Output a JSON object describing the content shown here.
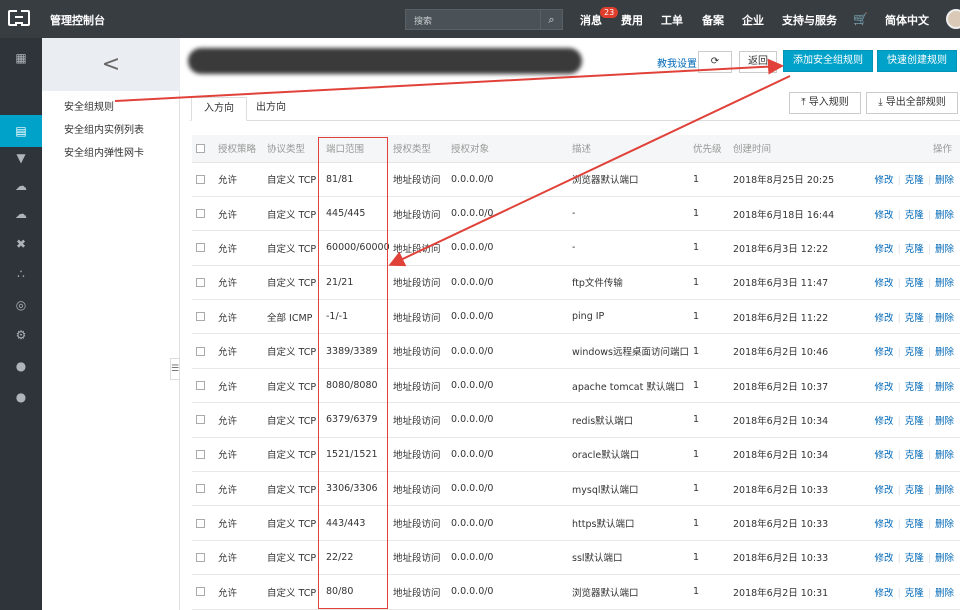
{
  "topbar": {
    "title": "管理控制台",
    "search_placeholder": "搜索",
    "nav": {
      "messages": "消息",
      "message_count": "23",
      "billing": "费用",
      "tickets": "工单",
      "icp": "备案",
      "enterprise": "企业",
      "support": "支持与服务",
      "language": "简体中文"
    }
  },
  "icons": [
    "grid-icon",
    "server-icon",
    "database-icon",
    "cloud-icon",
    "upload-cloud-icon",
    "network-icon",
    "nodes-icon",
    "globe-icon",
    "gear-icon",
    "dot-icon",
    "dot-icon"
  ],
  "subnav": {
    "back": "<",
    "items": [
      "安全组规则",
      "安全组内实例列表",
      "安全组内弹性网卡"
    ]
  },
  "header": {
    "help": "教我设置",
    "refresh": "⟳",
    "back": "返回",
    "add_rule": "添加安全组规则",
    "quick_create": "快速创建规则"
  },
  "tabs": {
    "inbound": "入方向",
    "outbound": "出方向"
  },
  "toolbar": {
    "import": "导入规则",
    "export": "导出全部规则"
  },
  "table": {
    "headers": [
      "授权策略",
      "协议类型",
      "端口范围",
      "授权类型",
      "授权对象",
      "描述",
      "优先级",
      "创建时间",
      "操作"
    ],
    "actions": {
      "edit": "修改",
      "clone": "克隆",
      "delete": "删除"
    },
    "rows": [
      {
        "policy": "允许",
        "protocol": "自定义 TCP",
        "port": "81/81",
        "auth_type": "地址段访问",
        "target": "0.0.0.0/0",
        "desc": "浏览器默认端口",
        "priority": "1",
        "created": "2018年8月25日 20:25"
      },
      {
        "policy": "允许",
        "protocol": "自定义 TCP",
        "port": "445/445",
        "auth_type": "地址段访问",
        "target": "0.0.0.0/0",
        "desc": "-",
        "priority": "1",
        "created": "2018年6月18日 16:44"
      },
      {
        "policy": "允许",
        "protocol": "自定义 TCP",
        "port": "60000/60000",
        "auth_type": "地址段访问",
        "target": "0.0.0.0/0",
        "desc": "-",
        "priority": "1",
        "created": "2018年6月3日 12:22"
      },
      {
        "policy": "允许",
        "protocol": "自定义 TCP",
        "port": "21/21",
        "auth_type": "地址段访问",
        "target": "0.0.0.0/0",
        "desc": "ftp文件传输",
        "priority": "1",
        "created": "2018年6月3日 11:47"
      },
      {
        "policy": "允许",
        "protocol": "全部 ICMP",
        "port": "-1/-1",
        "auth_type": "地址段访问",
        "target": "0.0.0.0/0",
        "desc": "ping IP",
        "priority": "1",
        "created": "2018年6月2日 11:22"
      },
      {
        "policy": "允许",
        "protocol": "自定义 TCP",
        "port": "3389/3389",
        "auth_type": "地址段访问",
        "target": "0.0.0.0/0",
        "desc": "windows远程桌面访问端口",
        "priority": "1",
        "created": "2018年6月2日 10:46"
      },
      {
        "policy": "允许",
        "protocol": "自定义 TCP",
        "port": "8080/8080",
        "auth_type": "地址段访问",
        "target": "0.0.0.0/0",
        "desc": "apache tomcat 默认端口",
        "priority": "1",
        "created": "2018年6月2日 10:37"
      },
      {
        "policy": "允许",
        "protocol": "自定义 TCP",
        "port": "6379/6379",
        "auth_type": "地址段访问",
        "target": "0.0.0.0/0",
        "desc": "redis默认端口",
        "priority": "1",
        "created": "2018年6月2日 10:34"
      },
      {
        "policy": "允许",
        "protocol": "自定义 TCP",
        "port": "1521/1521",
        "auth_type": "地址段访问",
        "target": "0.0.0.0/0",
        "desc": "oracle默认端口",
        "priority": "1",
        "created": "2018年6月2日 10:34"
      },
      {
        "policy": "允许",
        "protocol": "自定义 TCP",
        "port": "3306/3306",
        "auth_type": "地址段访问",
        "target": "0.0.0.0/0",
        "desc": "mysql默认端口",
        "priority": "1",
        "created": "2018年6月2日 10:33"
      },
      {
        "policy": "允许",
        "protocol": "自定义 TCP",
        "port": "443/443",
        "auth_type": "地址段访问",
        "target": "0.0.0.0/0",
        "desc": "https默认端口",
        "priority": "1",
        "created": "2018年6月2日 10:33"
      },
      {
        "policy": "允许",
        "protocol": "自定义 TCP",
        "port": "22/22",
        "auth_type": "地址段访问",
        "target": "0.0.0.0/0",
        "desc": "ssl默认端口",
        "priority": "1",
        "created": "2018年6月2日 10:33"
      },
      {
        "policy": "允许",
        "protocol": "自定义 TCP",
        "port": "80/80",
        "auth_type": "地址段访问",
        "target": "0.0.0.0/0",
        "desc": "浏览器默认端口",
        "priority": "1",
        "created": "2018年6月2日 10:31"
      }
    ]
  },
  "colors": {
    "accent": "#00a2ca",
    "link": "#0068b7",
    "annotation": "#e0423a",
    "topbar": "#373d41"
  }
}
